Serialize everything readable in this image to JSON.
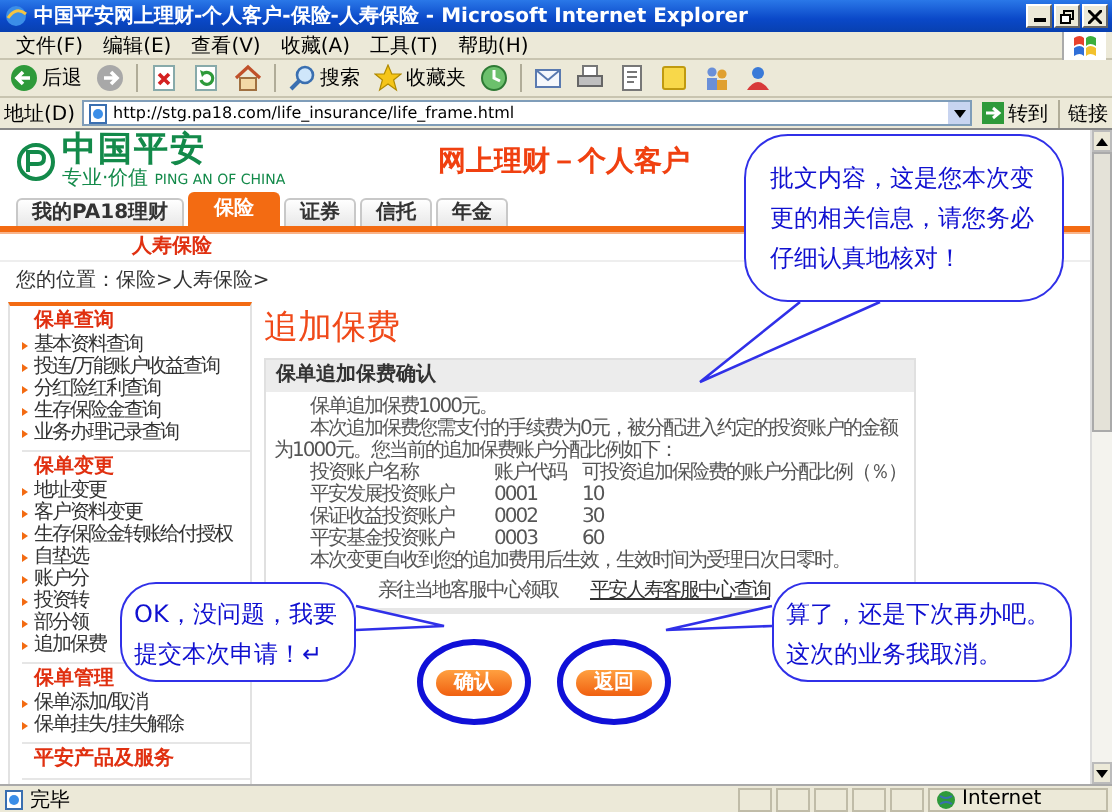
{
  "window": {
    "title": "中国平安网上理财-个人客户-保险-人寿保险 - Microsoft Internet Explorer"
  },
  "menu": [
    "文件(F)",
    "编辑(E)",
    "查看(V)",
    "收藏(A)",
    "工具(T)",
    "帮助(H)"
  ],
  "toolbar": [
    {
      "kind": "back",
      "label": "后退"
    },
    {
      "kind": "forward"
    },
    {
      "kind": "stop"
    },
    {
      "kind": "refresh"
    },
    {
      "kind": "home"
    },
    {
      "kind": "search",
      "label": "搜索"
    },
    {
      "kind": "favorites",
      "label": "收藏夹"
    },
    {
      "kind": "history"
    },
    {
      "kind": "mail"
    },
    {
      "kind": "print"
    },
    {
      "kind": "edit"
    },
    {
      "kind": "note"
    },
    {
      "kind": "people"
    },
    {
      "kind": "user"
    }
  ],
  "address_bar": {
    "label": "地址(D)",
    "url": "http://stg.pa18.com/life_insurance/life_frame.html",
    "go": "转到",
    "links": "链接"
  },
  "site": {
    "logo_name": "中国平安",
    "logo_tagline": "专业·价值",
    "logo_english": "PING AN OF CHINA",
    "title": "网上理财－个人客户"
  },
  "tabs": [
    {
      "label": "我的PA18理财",
      "selected": false
    },
    {
      "label": "保险",
      "selected": true
    },
    {
      "label": "证券",
      "selected": false
    },
    {
      "label": "信托",
      "selected": false
    },
    {
      "label": "年金",
      "selected": false
    }
  ],
  "subnav": "人寿保险",
  "breadcrumb": "您的位置：保险>人寿保险>",
  "sidebar": [
    {
      "title": "保单查询",
      "items": [
        "基本资料查询",
        "投连/万能账户收益查询",
        "分红险红利查询",
        "生存保险金查询",
        "业务办理记录查询"
      ]
    },
    {
      "title": "保单变更",
      "items": [
        "地址变更",
        "客户资料变更",
        "生存保险金转账给付授权",
        "自垫选",
        "账户分",
        "投资转",
        "部分领",
        "追加保费"
      ]
    },
    {
      "title": "保单管理",
      "items": [
        "保单添加/取消",
        "保单挂失/挂失解除"
      ]
    },
    {
      "title": "平安产品及服务"
    }
  ],
  "main": {
    "heading": "追加保费",
    "panel": {
      "title": "保单追加保费确认",
      "intro": "保单追加保费1000元。",
      "detail": "本次追加保费您需支付的手续费为0元，被分配进入约定的投资账户的金额为1000元。您当前的追加保费账户分配比例如下：",
      "table": {
        "columns": [
          "投资账户名称",
          "账户代码",
          "可投资追加保险费的账户分配比例（％）"
        ],
        "rows": [
          [
            "平安发展投资账户",
            "0001",
            "10"
          ],
          [
            "保证收益投资账户",
            "0002",
            "30"
          ],
          [
            "平安基金投资账户",
            "0003",
            "60"
          ]
        ]
      },
      "note": "本次变更自收到您的追加费用后生效，生效时间为受理日次日零时。",
      "pickup": "亲往当地客服中心领取",
      "pickup_link": "平安人寿客服中心查询"
    },
    "buttons": [
      {
        "label": "确认",
        "circled": true
      },
      {
        "label": "返回",
        "circled": true
      }
    ]
  },
  "callouts": [
    {
      "text": "批文内容，这是您本次变更的相关信息，请您务必仔细认真地核对！"
    },
    {
      "text": "OK，没问题，我要提交本次申请！↵"
    },
    {
      "text": "算了，还是下次再办吧。这次的业务我取消。"
    }
  ],
  "status_bar": {
    "text": "完毕",
    "zone": "Internet"
  }
}
